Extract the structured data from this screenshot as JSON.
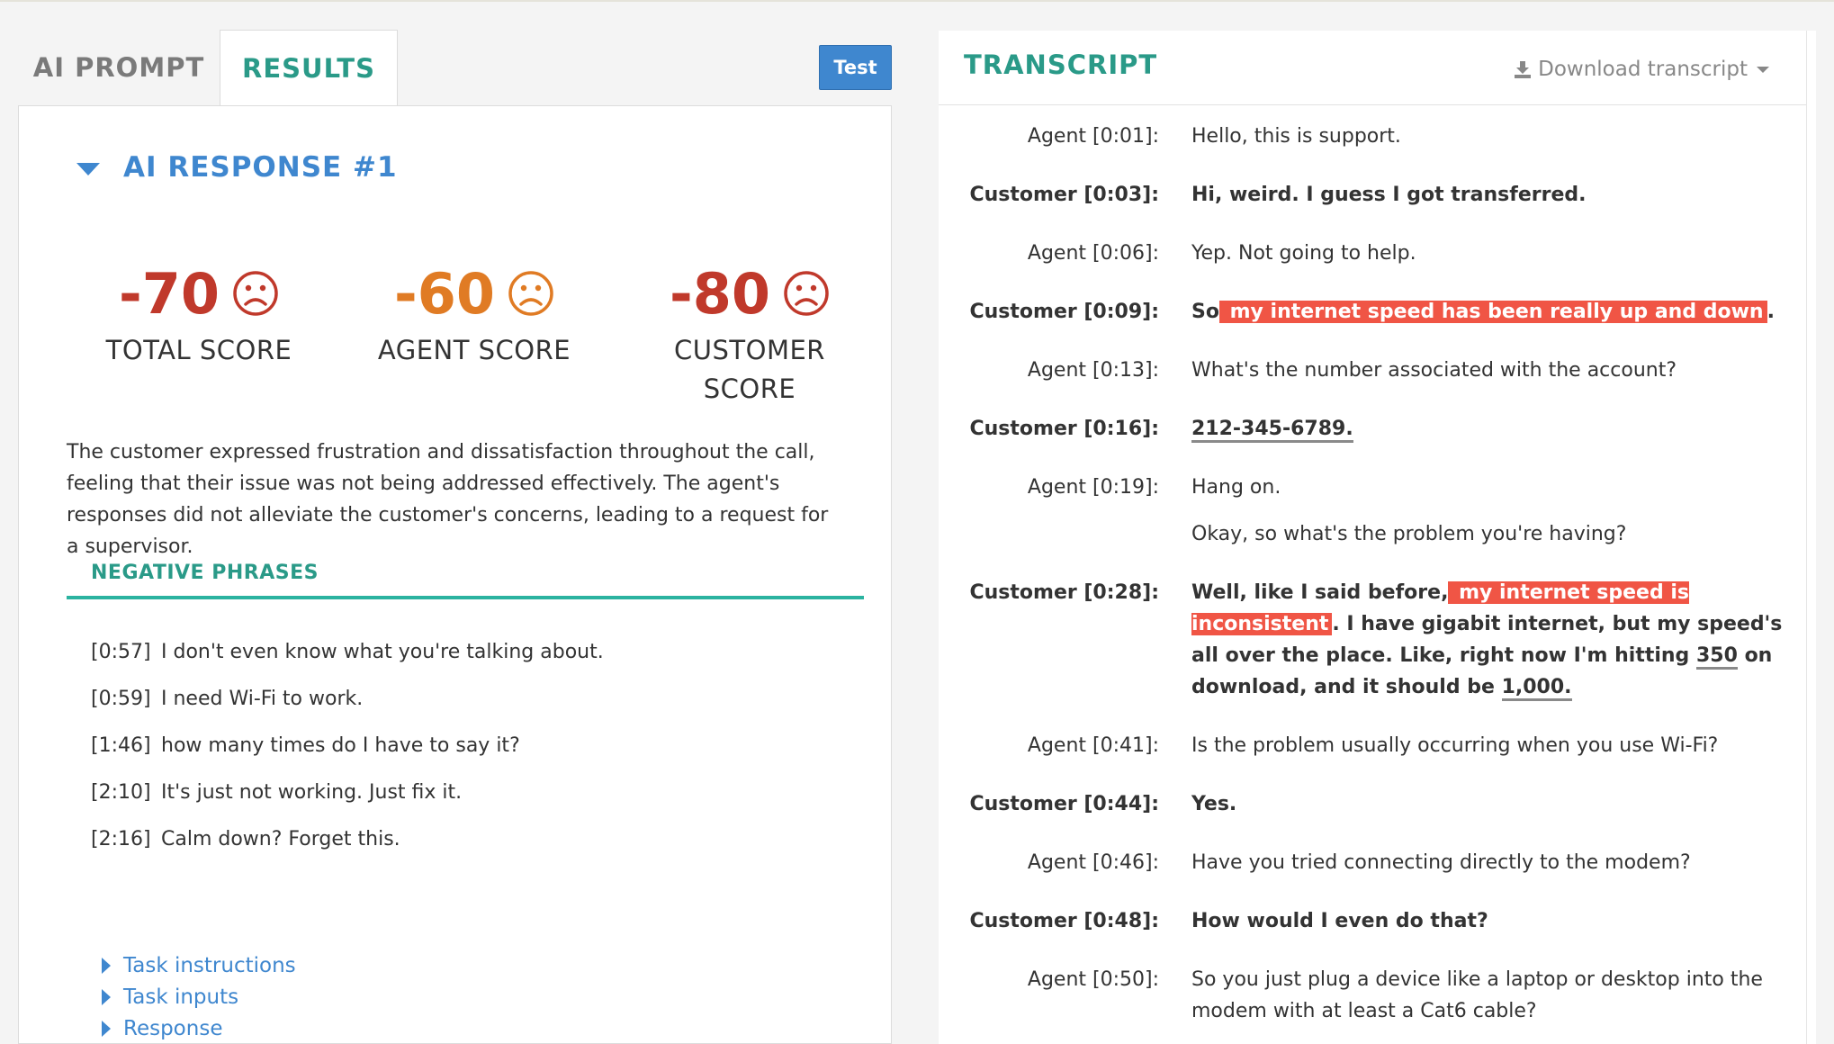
{
  "tabs": {
    "prompt": "AI PROMPT",
    "results": "RESULTS"
  },
  "test_button": "Test",
  "response": {
    "title": "AI RESPONSE #1",
    "scores": [
      {
        "value": "-70",
        "label": "TOTAL SCORE",
        "color": "#c0392b"
      },
      {
        "value": "-60",
        "label": "AGENT SCORE",
        "color": "#e07b24"
      },
      {
        "value": "-80",
        "label": "CUSTOMER SCORE",
        "color": "#c0392b"
      }
    ],
    "summary": "The customer expressed frustration and dissatisfaction throughout the call, feeling that their issue was not being addressed effectively. The agent's responses did not alleviate the customer's concerns, leading to a request for a supervisor."
  },
  "negative_phrases": {
    "title": "NEGATIVE PHRASES",
    "items": [
      {
        "time": "[0:57]",
        "text": "I don't even know what you're talking about."
      },
      {
        "time": "[0:59]",
        "text": "I need Wi-Fi to work."
      },
      {
        "time": "[1:46]",
        "text": "how many times do I have to say it?"
      },
      {
        "time": "[2:10]",
        "text": "It's just not working. Just fix it."
      },
      {
        "time": "[2:16]",
        "text": "Calm down? Forget this."
      }
    ]
  },
  "links": [
    "Task instructions",
    "Task inputs",
    "Response"
  ],
  "transcript": {
    "title": "TRANSCRIPT",
    "download_label": "Download transcript",
    "lines": [
      {
        "speaker": "Agent [0:01]:",
        "text": "Hello, this is support."
      },
      {
        "speaker": "Customer [0:03]:",
        "text": "Hi, weird. I guess I got transferred."
      },
      {
        "speaker": "Agent [0:06]:",
        "text": "Yep. Not going to help."
      },
      {
        "speaker": "Customer [0:09]:",
        "pre": "So",
        "hl": " my internet speed has been really up and down",
        "post": "."
      },
      {
        "speaker": "Agent [0:13]:",
        "text": "What's the number associated with the account?"
      },
      {
        "speaker": "Customer [0:16]:",
        "ul": "212-345-6789."
      },
      {
        "speaker": "Agent [0:19]:",
        "text": "Hang on."
      },
      {
        "speaker": "",
        "text": "Okay, so what's the problem you're having?"
      },
      {
        "speaker": "Customer [0:28]:",
        "p1": "Well, like I said before,",
        "hl": " my internet speed is inconsistent",
        "p2": ". I have gigabit internet, but my speed's all over the place. Like, right now I'm hitting ",
        "u1": "350",
        "p3": " on download, and it should be ",
        "u2": "1,000."
      },
      {
        "speaker": "Agent [0:41]:",
        "text": "Is the problem usually occurring when you use Wi-Fi?"
      },
      {
        "speaker": "Customer [0:44]:",
        "text": "Yes."
      },
      {
        "speaker": "Agent [0:46]:",
        "text": "Have you tried connecting directly to the modem?"
      },
      {
        "speaker": "Customer [0:48]:",
        "text": "How would I even do that?"
      },
      {
        "speaker": "Agent [0:50]:",
        "text": "So you just plug a device like a laptop or desktop into the modem with at least a Cat6 cable?"
      }
    ]
  }
}
